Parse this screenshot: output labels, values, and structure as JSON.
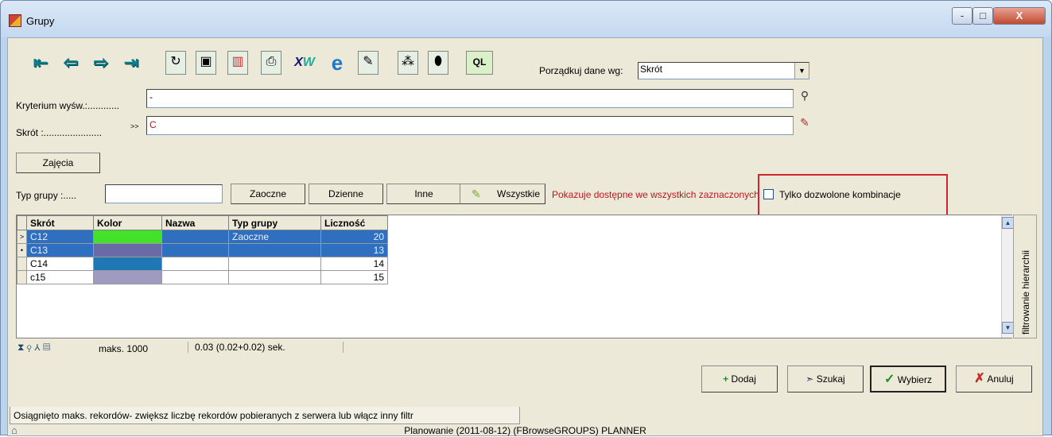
{
  "window": {
    "title": "Grupy",
    "min_label": "-",
    "max_label": "□",
    "close_label": "X"
  },
  "toolbar": {
    "icons": [
      "first-record-icon",
      "prev-record-icon",
      "next-record-icon",
      "last-record-icon",
      "refresh-icon",
      "copy-icon",
      "chart-icon",
      "print-icon",
      "excel-export-icon",
      "internet-icon",
      "edit-icon",
      "wand-icon",
      "filter-icon",
      "sql-icon"
    ],
    "sort_label": "Porządkuj dane wg:",
    "sort_value": "Skrót"
  },
  "filters": {
    "criteria_label": "Kryterium wyśw.:............",
    "criteria_value": "-",
    "abbr_label": "Skrót :......................",
    "abbr_arrow": ">>",
    "abbr_value": "C"
  },
  "zajecia_button": "Zajęcia",
  "type_bar": {
    "label": "Typ grupy :.....",
    "value": "",
    "buttons": [
      "Zaoczne",
      "Dzienne",
      "Inne",
      "Wszystkie"
    ],
    "info": "Pokazuje dostępne we wszystkich zaznaczonych",
    "checkbox_label": "Tylko dozwolone kombinacje"
  },
  "grid": {
    "columns": [
      "Skrót",
      "Kolor",
      "Nazwa",
      "Typ grupy",
      "Liczność"
    ],
    "rows": [
      {
        "indicator": ">",
        "abbr": "C12",
        "color": "#44e12b",
        "name": "",
        "type": "Zaoczne",
        "count": "20",
        "selected": true
      },
      {
        "indicator": "•",
        "abbr": "C13",
        "color": "#6a6aa6",
        "name": "",
        "type": "",
        "count": "13",
        "selected": true
      },
      {
        "indicator": "",
        "abbr": "C14",
        "color": "#1f78b3",
        "name": "",
        "type": "",
        "count": "14",
        "selected": false
      },
      {
        "indicator": "",
        "abbr": "c15",
        "color": "#9e9ac0",
        "name": "",
        "type": "",
        "count": "15",
        "selected": false
      }
    ]
  },
  "side_tab": "filtrowanie hierarchii",
  "gridstatus": {
    "max_label": "maks. 1000",
    "time_label": "0.03 (0.02+0.02) sek."
  },
  "actions": {
    "add": "Dodaj",
    "search": "Szukaj",
    "choose": "Wybierz",
    "cancel": "Anuluj"
  },
  "message": "Osiągnięto maks. rekordów- zwiększ liczbę rekordów pobieranych z serwera lub włącz inny filtr",
  "footer": "Planowanie (2011-08-12) (FBrowseGROUPS)    PLANNER",
  "colors": {
    "selection": "#2f6fbf",
    "highlight_box": "#d0252a",
    "info_text": "#c0151f"
  }
}
